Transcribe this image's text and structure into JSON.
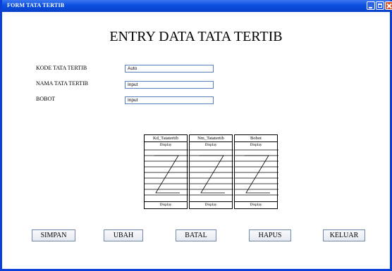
{
  "window": {
    "title": "FORM TATA TERTIB"
  },
  "heading": "ENTRY DATA TATA TERTIB",
  "form": {
    "kode": {
      "label": "KODE TATA TERTIB",
      "value": "Auto"
    },
    "nama": {
      "label": "NAMA TATA TERTIB",
      "value": "Input"
    },
    "bobot": {
      "label": "BOBOT",
      "value": "Input"
    }
  },
  "grid": {
    "columns": [
      {
        "header": "Kd_Tatatertib",
        "top": "Display",
        "bottom": "Display"
      },
      {
        "header": "Nm_Tatatertib",
        "top": "Display",
        "bottom": "Display"
      },
      {
        "header": "Bobot",
        "top": "Display",
        "bottom": "Display"
      }
    ]
  },
  "buttons": {
    "simpan": "SIMPAN",
    "ubah": "UBAH",
    "batal": "BATAL",
    "hapus": "HAPUS",
    "keluar": "KELUAR"
  },
  "colors": {
    "titlebar": "#0b4fe0",
    "frame": "#0a3fd8",
    "field_border": "#5b7fb8"
  }
}
